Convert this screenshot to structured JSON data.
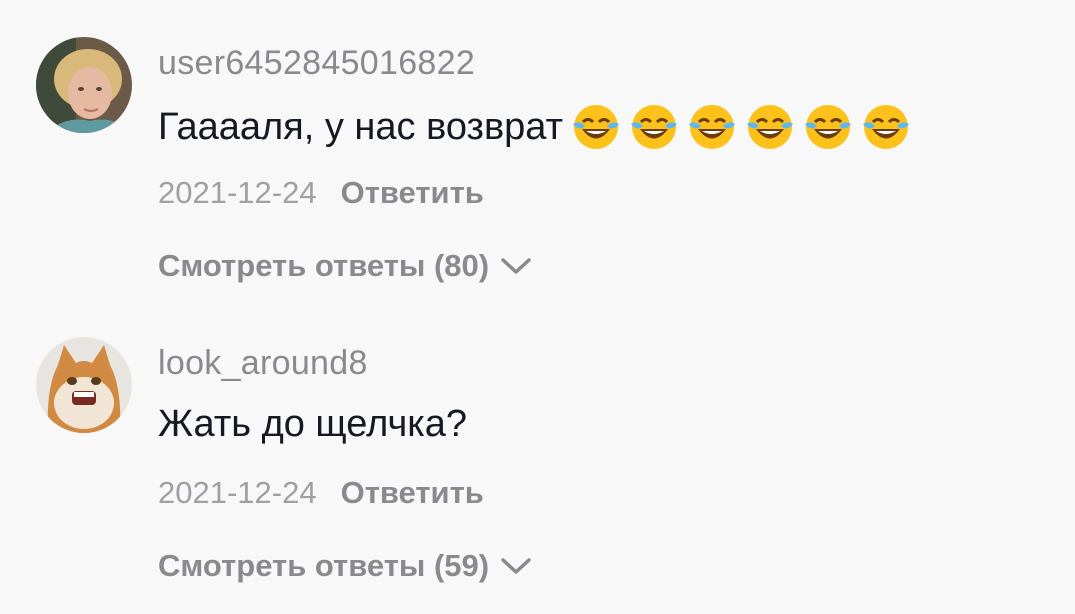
{
  "comments": [
    {
      "username": "user6452845016822",
      "text": "Гааааля, у нас возврат",
      "emoji": [
        "face-with-tears-of-joy-icon",
        "face-with-tears-of-joy-icon",
        "face-with-tears-of-joy-icon",
        "face-with-tears-of-joy-icon",
        "face-with-tears-of-joy-icon",
        "face-with-tears-of-joy-icon"
      ],
      "date": "2021-12-24",
      "reply_label": "Ответить",
      "view_replies_label": "Смотреть ответы (80)",
      "avatar": "woman-avatar"
    },
    {
      "username": "look_around8",
      "text": "Жать до щелчка?",
      "date": "2021-12-24",
      "reply_label": "Ответить",
      "view_replies_label": "Смотреть ответы (59)",
      "avatar": "cat-avatar"
    }
  ],
  "colors": {
    "background": "#f8f8f8",
    "username": "#8a8a8e",
    "text": "#161823",
    "date": "#a0a0a4"
  }
}
